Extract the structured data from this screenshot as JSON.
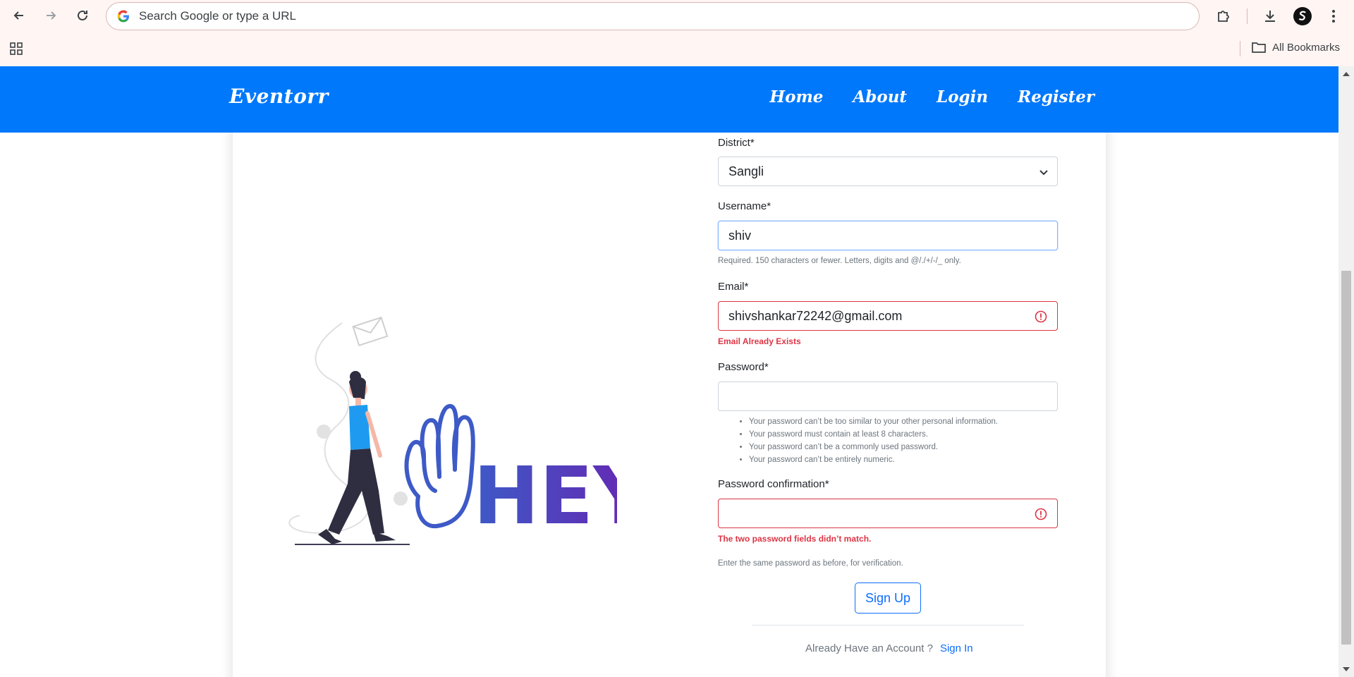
{
  "browser": {
    "omnibox_text": "Search Google or type a URL",
    "bookmarks_label": "All Bookmarks"
  },
  "site": {
    "brand": "Eventorr",
    "nav": [
      "Home",
      "About",
      "Login",
      "Register"
    ]
  },
  "illustration": {
    "text": "HEY"
  },
  "form": {
    "district": {
      "label": "District*",
      "value": "Sangli"
    },
    "username": {
      "label": "Username*",
      "value": "shiv",
      "help": "Required. 150 characters or fewer. Letters, digits and @/./+/-/_ only."
    },
    "email": {
      "label": "Email*",
      "value": "shivshankar72242@gmail.com",
      "error": "Email Already Exists"
    },
    "password": {
      "label": "Password*",
      "value": "",
      "rules": [
        "Your password can’t be too similar to your other personal information.",
        "Your password must contain at least 8 characters.",
        "Your password can’t be a commonly used password.",
        "Your password can’t be entirely numeric."
      ]
    },
    "password_confirm": {
      "label": "Password confirmation*",
      "value": "",
      "error": "The two password fields didn’t match.",
      "help": "Enter the same password as before, for verification."
    },
    "submit_label": "Sign Up",
    "account_prompt": "Already Have an Account ?",
    "signin_label": "Sign In"
  },
  "colors": {
    "navbar": "#0078fb",
    "error": "#dc3545",
    "primary": "#0d6efd",
    "chrome": "#fff5f3"
  },
  "icons": [
    "back-arrow-icon",
    "forward-arrow-icon",
    "reload-icon",
    "google-icon",
    "extensions-icon",
    "download-icon",
    "profile-icon",
    "menu-icon",
    "apps-icon",
    "folder-icon",
    "error-icon",
    "chevron-down-icon"
  ]
}
